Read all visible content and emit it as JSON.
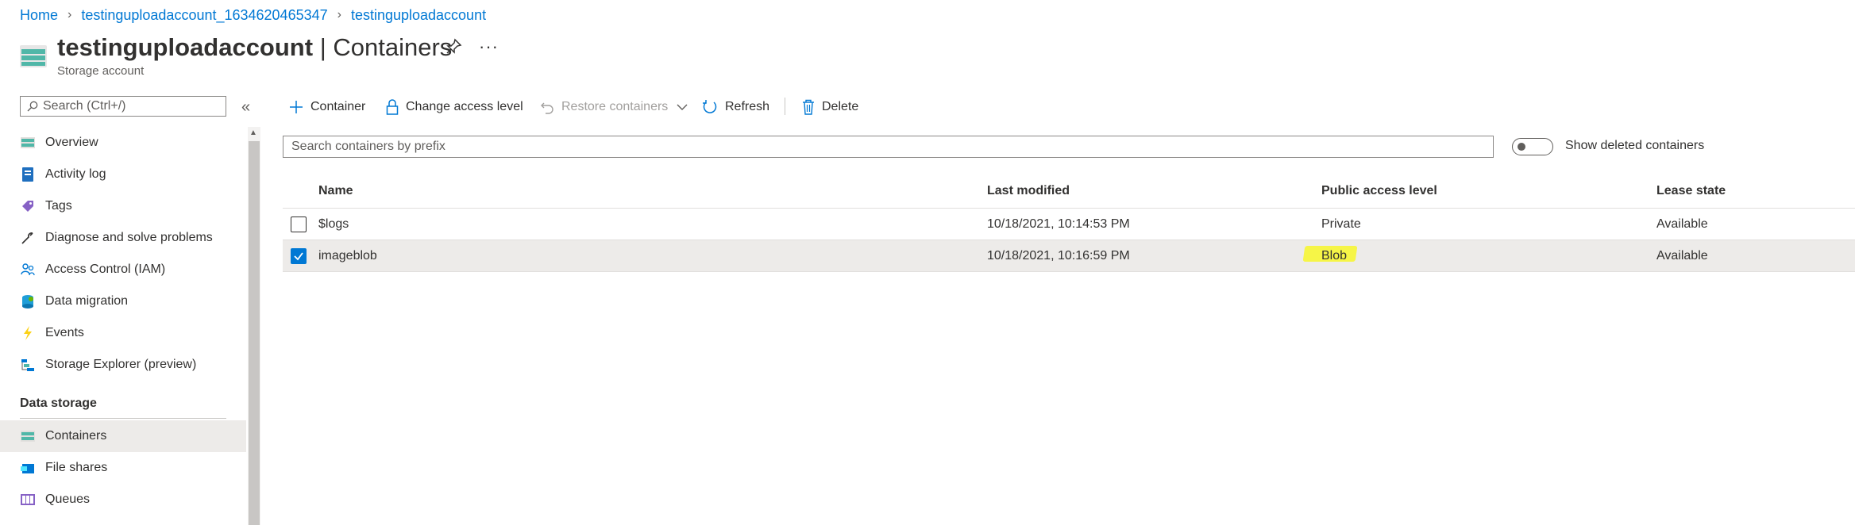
{
  "breadcrumb": [
    "Home",
    "testinguploadaccount_1634620465347",
    "testinguploadaccount"
  ],
  "header": {
    "title_name": "testinguploadaccount",
    "title_suffix": " | Containers",
    "subtitle": "Storage account",
    "more": "···"
  },
  "sidebar": {
    "search_placeholder": "Search (Ctrl+/)",
    "collapse": "«",
    "items": [
      {
        "label": "Overview",
        "icon": "overview-icon"
      },
      {
        "label": "Activity log",
        "icon": "activity-log-icon"
      },
      {
        "label": "Tags",
        "icon": "tag-icon"
      },
      {
        "label": "Diagnose and solve problems",
        "icon": "wrench-icon"
      },
      {
        "label": "Access Control (IAM)",
        "icon": "people-icon"
      },
      {
        "label": "Data migration",
        "icon": "data-migration-icon"
      },
      {
        "label": "Events",
        "icon": "lightning-icon"
      },
      {
        "label": "Storage Explorer (preview)",
        "icon": "storage-explorer-icon"
      }
    ],
    "section": "Data storage",
    "storage_items": [
      {
        "label": "Containers",
        "icon": "containers-icon",
        "active": true
      },
      {
        "label": "File shares",
        "icon": "file-shares-icon"
      },
      {
        "label": "Queues",
        "icon": "queues-icon"
      }
    ]
  },
  "toolbar": {
    "container": "Container",
    "change_access": "Change access level",
    "restore": "Restore containers",
    "refresh": "Refresh",
    "delete": "Delete"
  },
  "search_containers_placeholder": "Search containers by prefix",
  "show_deleted_label": "Show deleted containers",
  "table": {
    "columns": [
      "Name",
      "Last modified",
      "Public access level",
      "Lease state"
    ],
    "rows": [
      {
        "name": "$logs",
        "modified": "10/18/2021, 10:14:53 PM",
        "access": "Private",
        "lease": "Available",
        "selected": false
      },
      {
        "name": "imageblob",
        "modified": "10/18/2021, 10:16:59 PM",
        "access": "Blob",
        "lease": "Available",
        "selected": true
      }
    ]
  },
  "colors": {
    "accent": "#0078d4",
    "highlight": "#f7f72a",
    "selected_row": "#edebe9"
  }
}
